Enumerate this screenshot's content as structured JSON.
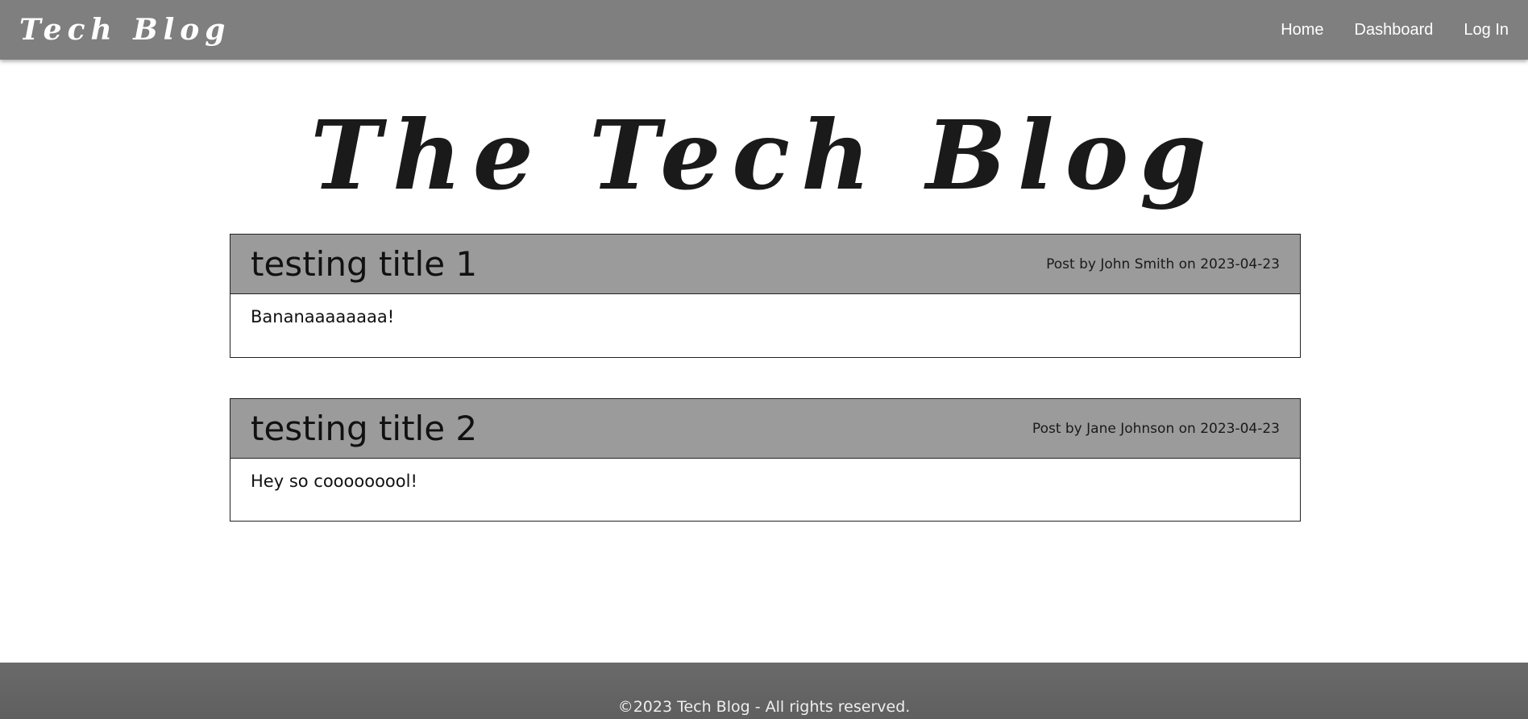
{
  "navbar": {
    "brand": "Tech Blog",
    "links": [
      {
        "label": "Home"
      },
      {
        "label": "Dashboard"
      },
      {
        "label": "Log In"
      }
    ]
  },
  "hero": {
    "title": "The Tech Blog"
  },
  "posts": [
    {
      "title": "testing title 1",
      "meta": "Post by John Smith on 2023-04-23",
      "body": "Bananaaaaaaaa!"
    },
    {
      "title": "testing title 2",
      "meta": "Post by Jane Johnson on 2023-04-23",
      "body": "Hey so cooooooool!"
    }
  ],
  "footer": {
    "text": "©2023 Tech Blog - All rights reserved."
  },
  "colors": {
    "navbar_bg": "#7f7f7f",
    "post_header_bg": "#9b9b9b",
    "footer_bg": "#636363",
    "page_bg": "#ffffff"
  }
}
